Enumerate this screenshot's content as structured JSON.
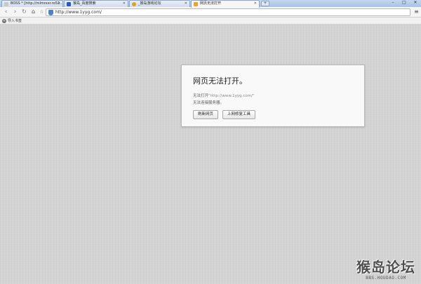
{
  "tabs": [
    {
      "label": "BOSS * [http://mlmrxxr.ro52...",
      "icon": "boss-icon",
      "color": "#c8c8c8"
    },
    {
      "label": "猴岛_百度搜索",
      "icon": "baidu-icon",
      "color": "#2a56c6"
    },
    {
      "label": "_猴岛游戏论坛",
      "icon": "houdao-icon",
      "color": "#e0a020"
    },
    {
      "label": "网页无法打开",
      "icon": "error-page-icon",
      "color": "#f0a030",
      "active": true
    }
  ],
  "new_tab_label": "+",
  "window_controls": {
    "minimize": "–",
    "maximize": "□",
    "close": "✕"
  },
  "toolbar": {
    "back": "‹",
    "forward": "›",
    "reload": "↻",
    "home": "⌂",
    "star": "☆",
    "url": "http://www.1yyg.com/",
    "menu": "≡"
  },
  "bookmarks": {
    "import_label": "导入书签",
    "import_icon": "+"
  },
  "error_page": {
    "title": "网页无法打开。",
    "line1_prefix": "无法打开",
    "line1_url": "\"http://www.1yyg.com/\"",
    "line2": "无法连接服务器。",
    "refresh_button": "刷新网页",
    "repair_button": "上网修复工具"
  },
  "watermark": {
    "main": "猴岛论坛",
    "sub": "BBS.HOUDAO.COM"
  }
}
